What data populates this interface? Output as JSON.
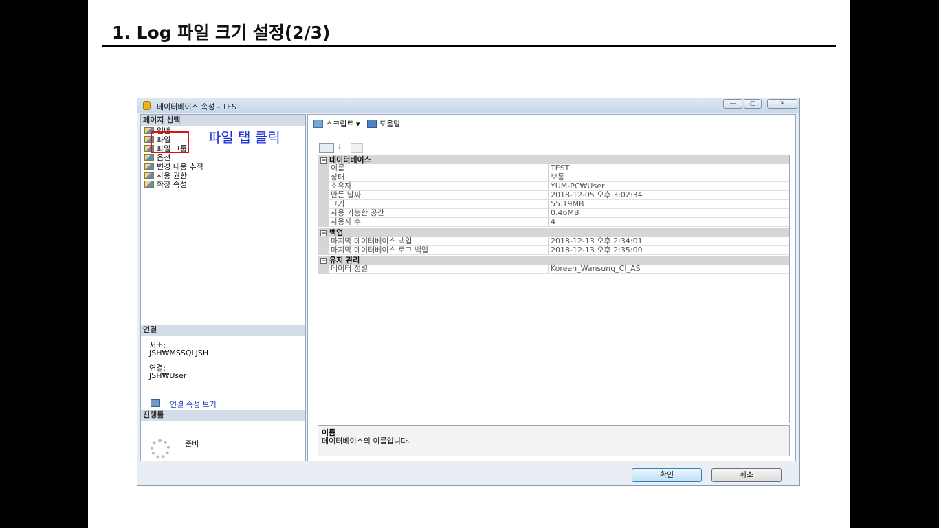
{
  "slide": {
    "title": "1. Log 파일 크기 설정(2/3)"
  },
  "window": {
    "title": "데이터베이스 속성 - TEST",
    "controls": {
      "minimize": "—",
      "maximize": "▢",
      "close": "✕"
    }
  },
  "left_pane": {
    "pages_header": "페이지 선택",
    "pages": [
      {
        "label": "일반"
      },
      {
        "label": "파일"
      },
      {
        "label": "파일 그룹"
      },
      {
        "label": "옵션"
      },
      {
        "label": "변경 내용 추적"
      },
      {
        "label": "사용 권한"
      },
      {
        "label": "확장 속성"
      }
    ],
    "annotation": "파일 탭 클릭",
    "connection_header": "연결",
    "server_label": "서버:",
    "server_value": "JSH₩MSSQLJSH",
    "connection_label": "연결:",
    "connection_value": "JSH₩User",
    "view_connection_link": "연결 속성 보기",
    "progress_header": "진행률",
    "progress_status": "준비"
  },
  "toolbar": {
    "script_label": "스크립트",
    "help_label": "도움말"
  },
  "property_grid": {
    "categories": [
      {
        "name": "데이터베이스",
        "rows": [
          {
            "name": "이름",
            "value": "TEST"
          },
          {
            "name": "상태",
            "value": "보통"
          },
          {
            "name": "소유자",
            "value": "YUM-PC₩User"
          },
          {
            "name": "만든 날짜",
            "value": "2018-12-05 오후 3:02:34"
          },
          {
            "name": "크기",
            "value": "55.19MB"
          },
          {
            "name": "사용 가능한 공간",
            "value": "0.46MB"
          },
          {
            "name": "사용자 수",
            "value": "4"
          }
        ]
      },
      {
        "name": "백업",
        "rows": [
          {
            "name": "마지막 데이터베이스 백업",
            "value": "2018-12-13 오후 2:34:01"
          },
          {
            "name": "마지막 데이터베이스 로그 백업",
            "value": "2018-12-13 오후 2:35:00"
          }
        ]
      },
      {
        "name": "유지 관리",
        "rows": [
          {
            "name": "데이터 정렬",
            "value": "Korean_Wansung_CI_AS"
          }
        ]
      }
    ]
  },
  "description": {
    "title": "이름",
    "text": "데이터베이스의 이름입니다."
  },
  "buttons": {
    "ok": "확인",
    "cancel": "취소"
  }
}
